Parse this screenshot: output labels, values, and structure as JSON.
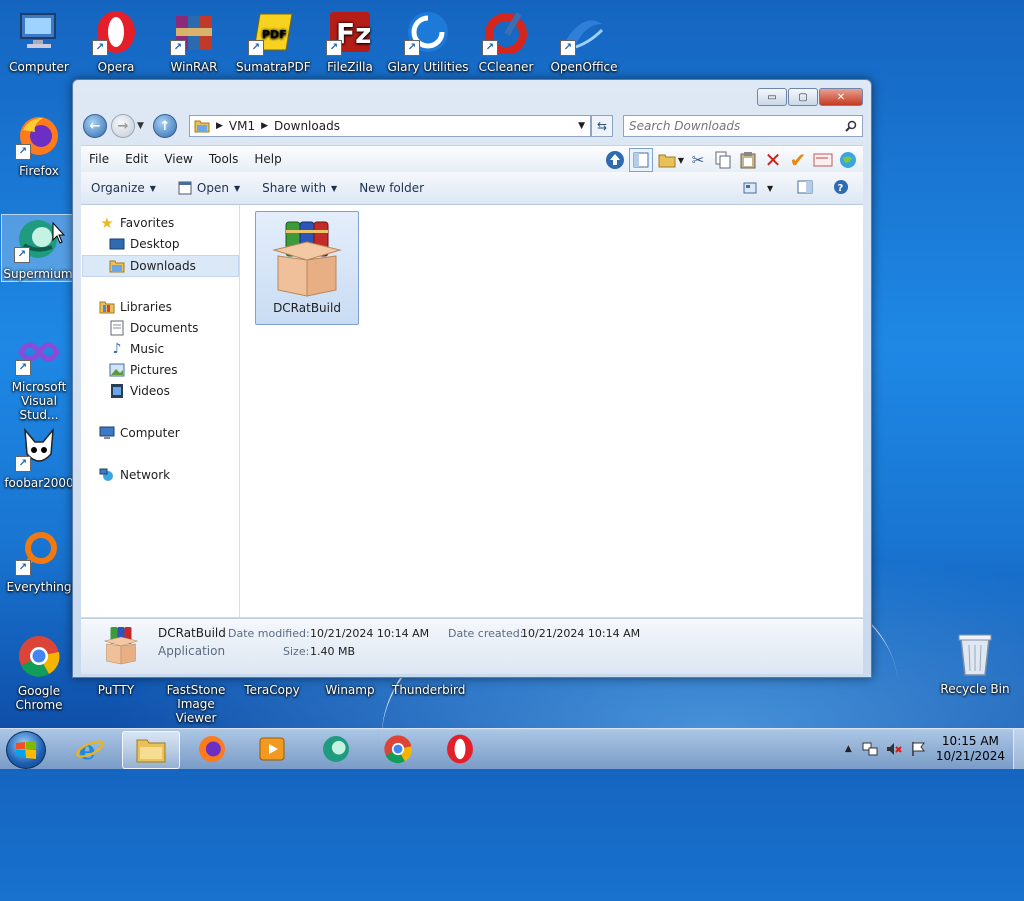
{
  "desktop": {
    "icons_top": [
      {
        "label": "Computer"
      },
      {
        "label": "Opera"
      },
      {
        "label": "WinRAR"
      },
      {
        "label": "SumatraPDF"
      },
      {
        "label": "FileZilla"
      },
      {
        "label": "Glary Utilities"
      },
      {
        "label": "CCleaner"
      },
      {
        "label": "OpenOffice"
      }
    ],
    "icons_left": [
      {
        "label": "Firefox"
      },
      {
        "label": "Supermium"
      },
      {
        "label": "Microsoft Visual Stud..."
      },
      {
        "label": "foobar2000"
      },
      {
        "label": "Everything"
      },
      {
        "label": "Google Chrome"
      }
    ],
    "icons_bottom": [
      {
        "label": "PuTTY"
      },
      {
        "label": "FastStone Image Viewer"
      },
      {
        "label": "TeraCopy"
      },
      {
        "label": "Winamp"
      },
      {
        "label": "Thunderbird"
      }
    ],
    "recycle_bin": {
      "label": "Recycle Bin"
    }
  },
  "window": {
    "controls": {
      "minimize": "▭",
      "maximize": "▢",
      "close": "✕"
    },
    "address": {
      "segments": [
        "VM1",
        "Downloads"
      ]
    },
    "search": {
      "placeholder": "Search Downloads"
    },
    "menu": [
      "File",
      "Edit",
      "View",
      "Tools",
      "Help"
    ],
    "commands": {
      "organize": "Organize",
      "open": "Open",
      "share_with": "Share with",
      "new_folder": "New folder"
    },
    "nav": {
      "favorites": "Favorites",
      "desktop": "Desktop",
      "downloads": "Downloads",
      "libraries": "Libraries",
      "documents": "Documents",
      "music": "Music",
      "pictures": "Pictures",
      "videos": "Videos",
      "computer": "Computer",
      "network": "Network"
    },
    "files": [
      {
        "name": "DCRatBuild"
      }
    ],
    "details": {
      "name": "DCRatBuild",
      "type": "Application",
      "date_modified_label": "Date modified:",
      "date_modified": "10/21/2024 10:14 AM",
      "date_created_label": "Date created:",
      "date_created": "10/21/2024 10:14 AM",
      "size_label": "Size:",
      "size": "1.40 MB"
    }
  },
  "taskbar": {
    "clock_time": "10:15 AM",
    "clock_date": "10/21/2024"
  },
  "colors": {
    "selection": "#c9dcf3",
    "accent": "#1e88e5",
    "close": "#c43b1f"
  }
}
